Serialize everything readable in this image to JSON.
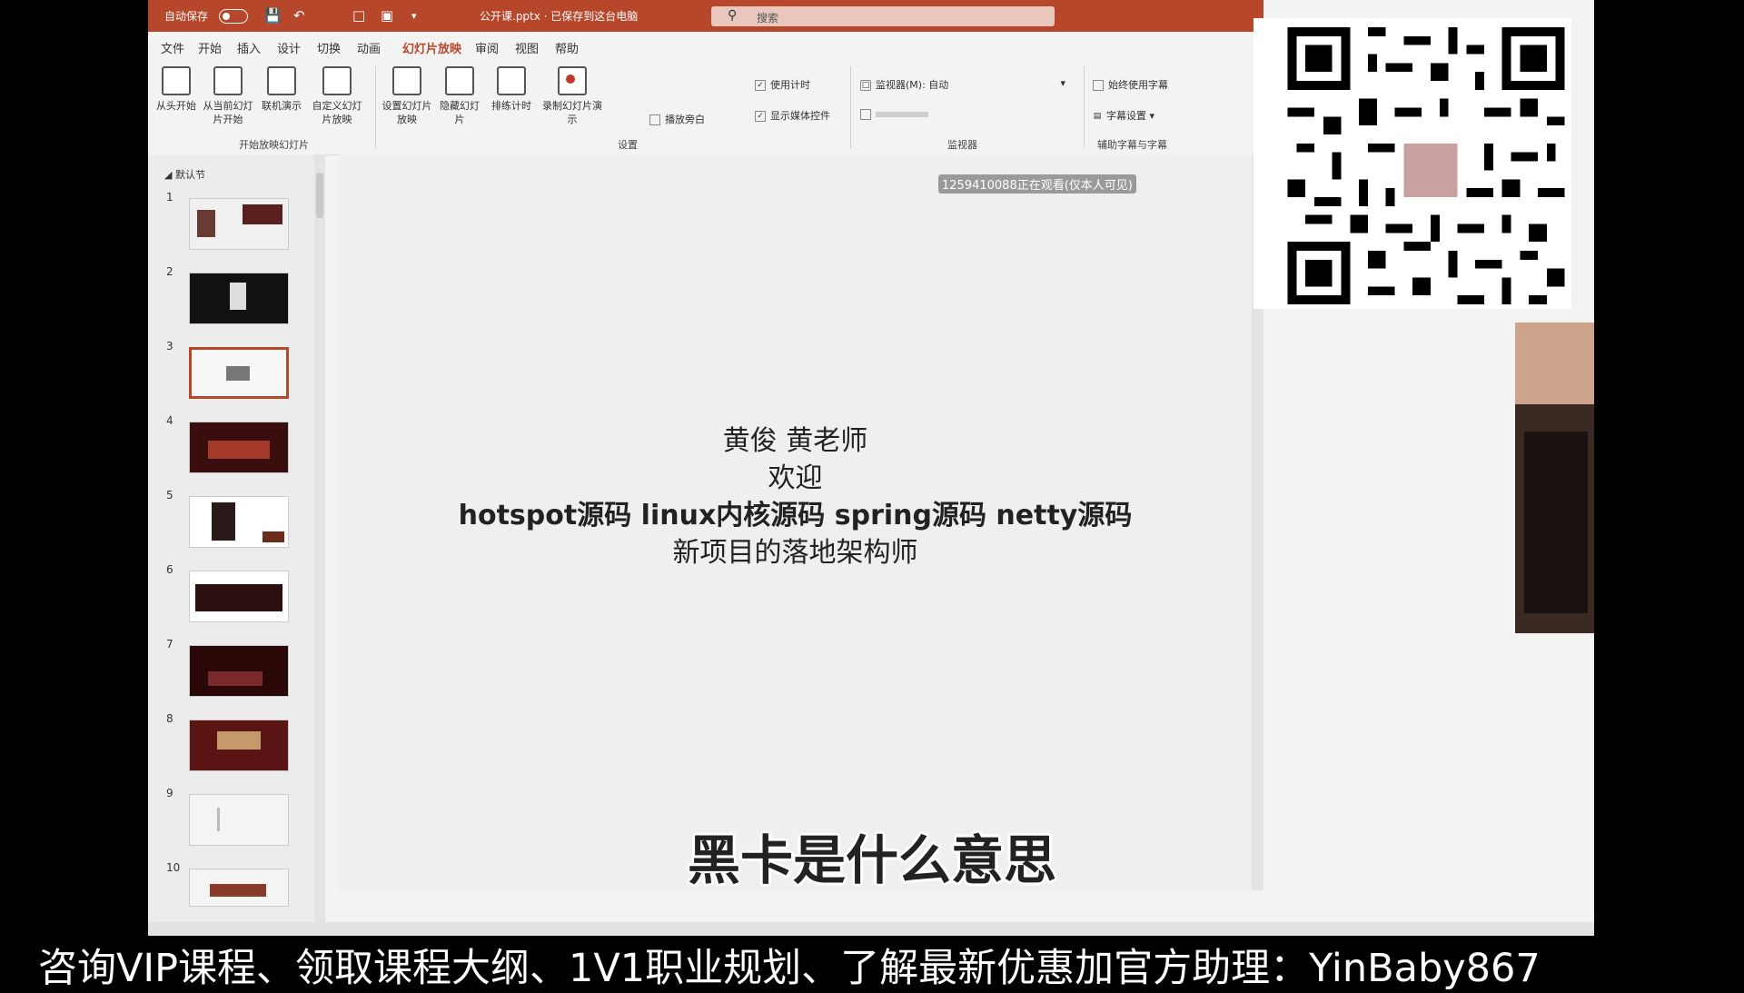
{
  "titlebar": {
    "autosave": "自动保存",
    "file_status": "公开课.pptx · 已保存到这台电脑",
    "search_placeholder": "搜索"
  },
  "tabs": [
    "文件",
    "开始",
    "插入",
    "设计",
    "切换",
    "动画",
    "幻灯片放映",
    "审阅",
    "视图",
    "帮助"
  ],
  "active_tab": "幻灯片放映",
  "ribbon": {
    "start_group": {
      "buttons": [
        "从头开始",
        "从当前幻灯片开始",
        "联机演示",
        "自定义幻灯片放映"
      ],
      "label": "开始放映幻灯片"
    },
    "setup_group": {
      "buttons": [
        "设置幻灯片放映",
        "隐藏幻灯片",
        "排练计时",
        "录制幻灯片演示"
      ],
      "checkboxes": [
        "播放旁白",
        "使用计时",
        "显示媒体控件"
      ],
      "label": "设置"
    },
    "monitor_group": {
      "monitor": "监视器(M): 自动",
      "label": "监视器"
    },
    "caption_group": {
      "items": [
        "始终使用字幕",
        "字幕设置"
      ],
      "label": "辅助字幕与字幕"
    }
  },
  "thumbnails": {
    "section_name": "默认节",
    "numbers": [
      "1",
      "2",
      "3",
      "4",
      "5",
      "6",
      "7",
      "8",
      "9",
      "10"
    ],
    "selected": 3
  },
  "slide": {
    "watermark": "1259410088正在观看(仅本人可见)",
    "lines": [
      "黄俊 黄老师",
      "欢迎",
      "hotspot源码 linux内核源码 spring源码 netty源码",
      "新项目的落地架构师"
    ]
  },
  "subtitle": "黑卡是什么意思",
  "banner": "咨询VIP课程、领取课程大纲、1V1职业规划、了解最新优惠加官方助理：YinBaby867",
  "colors": {
    "accent": "#b7472a",
    "background": "#000000"
  }
}
